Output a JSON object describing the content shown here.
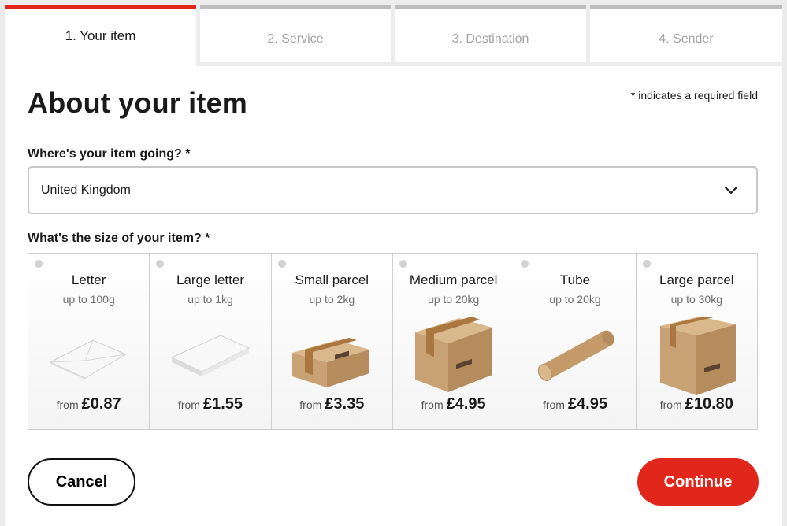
{
  "steps": [
    {
      "label": "1. Your item",
      "active": true
    },
    {
      "label": "2. Service",
      "active": false
    },
    {
      "label": "3. Destination",
      "active": false
    },
    {
      "label": "4. Sender",
      "active": false
    }
  ],
  "page": {
    "title": "About your item",
    "required_note": "* indicates a required field"
  },
  "destination": {
    "label": "Where's your item going? *",
    "value": "United Kingdom",
    "icon": "chevron-down-icon"
  },
  "size": {
    "label": "What's the size of your item? *",
    "options": [
      {
        "name": "Letter",
        "weight": "up to 100g",
        "from": "from",
        "price": "£0.87",
        "icon": "letter-envelope-icon"
      },
      {
        "name": "Large letter",
        "weight": "up to 1kg",
        "from": "from",
        "price": "£1.55",
        "icon": "large-letter-icon"
      },
      {
        "name": "Small parcel",
        "weight": "up to 2kg",
        "from": "from",
        "price": "£3.35",
        "icon": "small-parcel-icon"
      },
      {
        "name": "Medium parcel",
        "weight": "up to 20kg",
        "from": "from",
        "price": "£4.95",
        "icon": "medium-parcel-icon"
      },
      {
        "name": "Tube",
        "weight": "up to 20kg",
        "from": "from",
        "price": "£4.95",
        "icon": "tube-icon"
      },
      {
        "name": "Large parcel",
        "weight": "up to 30kg",
        "from": "from",
        "price": "£10.80",
        "icon": "large-parcel-icon"
      }
    ]
  },
  "actions": {
    "cancel": "Cancel",
    "continue": "Continue"
  },
  "colors": {
    "accent": "#e1261c",
    "tab_inactive_border": "#bdbdbd"
  }
}
